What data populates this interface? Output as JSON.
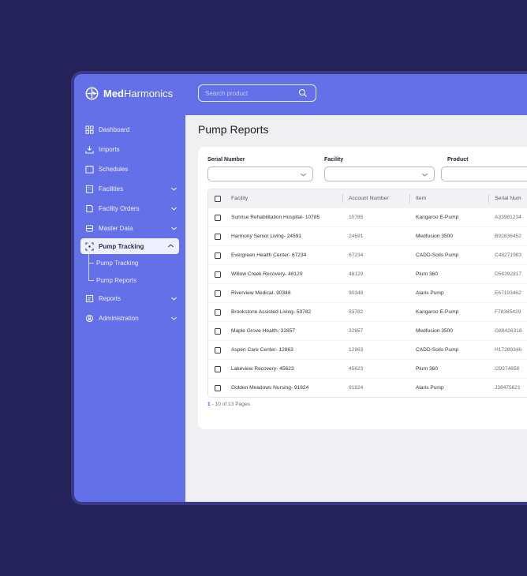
{
  "brand": {
    "name_bold": "Med",
    "name_light": "Harmonics"
  },
  "search": {
    "placeholder": "Search product"
  },
  "sidebar": {
    "items": [
      {
        "label": "Dashboard",
        "icon": "grid-icon"
      },
      {
        "label": "Imports",
        "icon": "import-icon"
      },
      {
        "label": "Schedules",
        "icon": "calendar-icon"
      },
      {
        "label": "Facilities",
        "icon": "building-icon",
        "expandable": true
      },
      {
        "label": "Facility Orders",
        "icon": "orders-icon",
        "expandable": true
      },
      {
        "label": "Master Data",
        "icon": "database-icon",
        "expandable": true
      },
      {
        "label": "Pump Tracking",
        "icon": "tracking-icon",
        "expandable": true,
        "active": true
      },
      {
        "label": "Reports",
        "icon": "reports-icon",
        "expandable": true
      },
      {
        "label": "Administration",
        "icon": "admin-icon",
        "expandable": true
      }
    ],
    "sub_items": [
      "Pump Tracking",
      "Pump Reports"
    ]
  },
  "page": {
    "title": "Pump Reports"
  },
  "filters": [
    {
      "label": "Serial Number"
    },
    {
      "label": "Facility"
    },
    {
      "label": "Product"
    }
  ],
  "table": {
    "headers": {
      "facility": "Facility",
      "account": "Account Number",
      "item": "Item",
      "serial": "Serial Num"
    },
    "rows": [
      {
        "facility": "Sunrise Rehabilitation Hospital- 10785",
        "account": "10785",
        "item": "Kangaroo E-Pump",
        "serial": "A33981234"
      },
      {
        "facility": "Harmony Senior Living- 24591",
        "account": "24591",
        "item": "Medfusion 3500",
        "serial": "B92836452"
      },
      {
        "facility": "Evergreen Health Center- 67234",
        "account": "67234",
        "item": "CADD-Solis Pump",
        "serial": "C48271983"
      },
      {
        "facility": "Willow Creek Recovery- 48129",
        "account": "48129",
        "item": "Plum 360",
        "serial": "D56392817"
      },
      {
        "facility": "Riverview Medical- 90348",
        "account": "90348",
        "item": "Alaris Pump",
        "serial": "E67193462"
      },
      {
        "facility": "Brookstone Assisted Living- 53782",
        "account": "53782",
        "item": "Kangaroo E-Pump",
        "serial": "F78365429"
      },
      {
        "facility": "Maple Grove Health- 32857",
        "account": "32857",
        "item": "Medfusion 3500",
        "serial": "G89426318"
      },
      {
        "facility": "Aspen Care Center- 12863",
        "account": "12863",
        "item": "CADD-Solis Pump",
        "serial": "H17289346"
      },
      {
        "facility": "Lakeview Recovery- 45623",
        "account": "45623",
        "item": "Plum 360",
        "serial": "I29374658"
      },
      {
        "facility": "Golden Meadows Nursing- 91824",
        "account": "91824",
        "item": "Alaris Pump",
        "serial": "J38475621"
      }
    ]
  },
  "pagination": {
    "current": "1",
    "rest": " - 10 of 13 Pages"
  },
  "colors": {
    "background": "#25225a",
    "sidebar": "#6470e8",
    "accent": "#3d4de0"
  }
}
